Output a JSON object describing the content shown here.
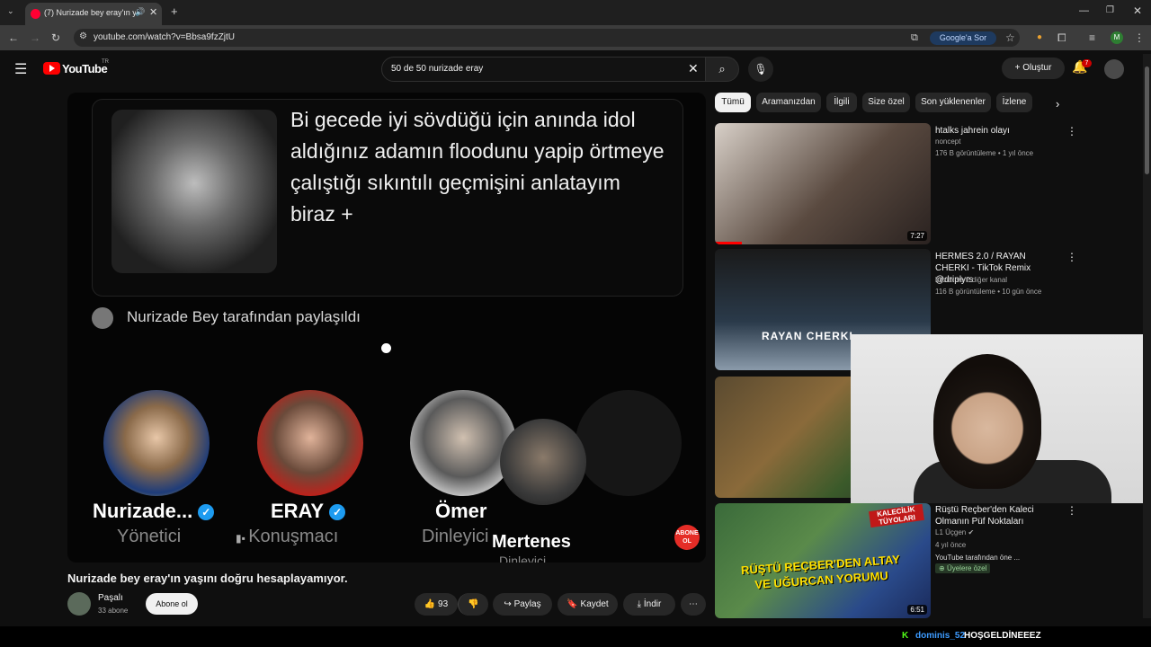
{
  "browser": {
    "tab_title": "(7) Nurizade bey eray'ın yaşı",
    "url": "youtube.com/watch?v=Bbsa9fzZjtU",
    "google_sor": "Google'a Sor",
    "profile_initial": "M"
  },
  "youtube": {
    "logo": "YouTube",
    "region": "TR",
    "search_query": "50 de 50 nurizade eray",
    "create_label": "Oluştur",
    "notif_count": "7"
  },
  "video": {
    "tweet_text": "Bi gecede iyi sövdüğü için anında idol aldığınız adamın floodunu yapip örtmeye çalıştığı sıkıntılı geçmişini anlatayım biraz +",
    "shared_by": "Nurizade Bey tarafından paylaşıldı",
    "speakers": [
      {
        "name": "Nurizade...",
        "role": "Yönetici"
      },
      {
        "name": "ERAY",
        "role": "Konuşmacı"
      },
      {
        "name": "Ömer",
        "role": "Dinleyici"
      },
      {
        "name": "Mertenes",
        "role": "Dinleyici"
      }
    ],
    "overlay_badge": "ABONE OL",
    "title": "Nurizade bey eray'ın yaşını doğru hesaplayamıyor.",
    "channel": "Paşalı",
    "subscribers": "33 abone",
    "subscribe_label": "Abone ol",
    "likes": "93",
    "share_label": "Paylaş",
    "save_label": "Kaydet",
    "download_label": "İndir"
  },
  "chips": [
    "Tümü",
    "Aramanızdan",
    "İlgili",
    "Size özel",
    "Son yüklenenler",
    "İzlene"
  ],
  "recommendations": [
    {
      "title": "htalks jahrein olayı",
      "channel": "noncept",
      "meta": "176 B görüntüleme • 1 yıl önce",
      "duration": "7:27"
    },
    {
      "title": "HERMES 2.0 / RAYAN CHERKI - TikTok Remix @driplyrs",
      "channel": "lrdzdx ve 2 diğer kanal",
      "meta": "116 B görüntüleme • 10 gün önce",
      "thumb_text": "RAYAN CHERKI"
    },
    {
      "title": "",
      "channel": "",
      "meta": ""
    },
    {
      "title": "Rüştü Reçber'den Kaleci Olmanın Püf Noktaları",
      "channel": "L1 Üçgen",
      "meta": "4 yıl önce",
      "extra": "YouTube tarafından öne ...",
      "badge": "Üyelere özel",
      "duration": "6:51",
      "thumb_text": "RÜŞTÜ REÇBER'DEN ALTAY VE UĞURCAN YORUMU",
      "thumb_tag": "KALECİLİK TÜYOLARI"
    }
  ],
  "chat": {
    "platform": "K",
    "user": "dominis_52",
    "message": "HOŞGELDİNEEEZ"
  },
  "colors": {
    "accent_red": "#ff0000",
    "verified": "#1d9bf0",
    "kick_green": "#53fc18"
  }
}
